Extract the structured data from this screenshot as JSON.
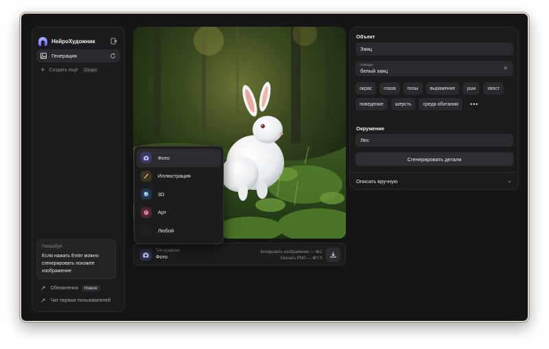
{
  "app": {
    "name": "НейроХудожник"
  },
  "sidebar": {
    "active_item": "Генерация",
    "create_label": "Создать ещё",
    "create_badge": "Скоро",
    "tip": {
      "title": "Попробуй",
      "text": "Если нажать Enter можно сгенерировать похожее изображение"
    },
    "links": [
      {
        "label": "Обновления",
        "badge": "Новое"
      },
      {
        "label": "Чат первых пользователей"
      }
    ]
  },
  "graphic_type": {
    "label": "Тип графики",
    "value": "Фото",
    "options": [
      {
        "label": "Фото",
        "icon": "camera-icon",
        "color": "#3a3a64",
        "active": true
      },
      {
        "label": "Иллюстрация",
        "icon": "brush-icon",
        "color": "#3d3424"
      },
      {
        "label": "3D",
        "icon": "sphere-icon",
        "color": "#22364a"
      },
      {
        "label": "Арт",
        "icon": "palette-icon",
        "color": "#4a2530"
      },
      {
        "label": "Любой",
        "icon": "empty-icon",
        "color": "#1f1f22"
      }
    ]
  },
  "shortcuts": {
    "copy": "Копировать изображение — ⌘C",
    "download": "Скачать PNG — ⌘⇧S"
  },
  "object_panel": {
    "title": "Объект",
    "value": "Заяц",
    "breed_label": "порода",
    "breed_value": "белый заяц",
    "chips": [
      "окрас",
      "глаза",
      "позы",
      "выражение",
      "уши",
      "хвост",
      "поведение",
      "шерсть",
      "среда обитания"
    ],
    "more": "•••"
  },
  "environment_panel": {
    "title": "Окружение",
    "value": "Лес",
    "generate_label": "Сгенерировать детали",
    "manual_label": "Описать вручную"
  }
}
